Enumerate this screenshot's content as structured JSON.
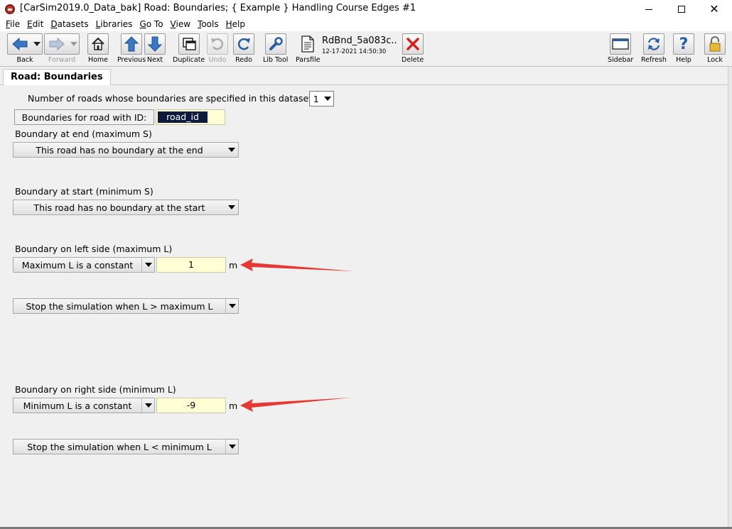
{
  "window": {
    "title": "[CarSim2019.0_Data_bak] Road: Boundaries; { Example } Handling Course Edges #1"
  },
  "menu": [
    {
      "label": "File",
      "key": "F",
      "rest": "ile"
    },
    {
      "label": "Edit",
      "key": "E",
      "rest": "dit"
    },
    {
      "label": "Datasets",
      "key": "D",
      "rest": "atasets"
    },
    {
      "label": "Libraries",
      "key": "L",
      "rest": "ibraries"
    },
    {
      "label": "Go To",
      "key": "G",
      "rest": "o To"
    },
    {
      "label": "View",
      "key": "V",
      "rest": "iew"
    },
    {
      "label": "Tools",
      "key": "T",
      "rest": "ools"
    },
    {
      "label": "Help",
      "key": "H",
      "rest": "elp"
    }
  ],
  "toolbar": {
    "back": "Back",
    "forward": "Forward",
    "home": "Home",
    "previous": "Previous",
    "next": "Next",
    "duplicate": "Duplicate",
    "undo": "Undo",
    "redo": "Redo",
    "libtool": "Lib Tool",
    "parsfile": "Parsfile",
    "parsfile_name": "RdBnd_5a083c..",
    "parsfile_date": "12-17-2021 14:50:30",
    "delete": "Delete",
    "sidebar": "Sidebar",
    "refresh": "Refresh",
    "help": "Help",
    "lock": "Lock"
  },
  "tab": {
    "label": "Road: Boundaries"
  },
  "form": {
    "num_roads_label": "Number of roads whose boundaries are specified in this dataset:",
    "num_roads_value": "1",
    "road_id_button": "Boundaries for road with ID:",
    "road_id_value": "road_id",
    "end_label": "Boundary at end (maximum S)",
    "end_option": "This road has no boundary at the end",
    "start_label": "Boundary at start (minimum S)",
    "start_option": "This road has no boundary at the start",
    "left_label": "Boundary on left side (maximum L)",
    "left_mode": "Maximum L is a constant",
    "left_value": "1",
    "left_unit": "m",
    "left_stop": "Stop the simulation when L > maximum L",
    "right_label": "Boundary on right side (minimum L)",
    "right_mode": "Minimum L is a constant",
    "right_value": "-9",
    "right_unit": "m",
    "right_stop": "Stop the simulation when L < minimum L"
  },
  "colors": {
    "input_bg": "#ffffd6",
    "annotation_arrow": "#e53935",
    "selection": "#0c1a3d"
  }
}
